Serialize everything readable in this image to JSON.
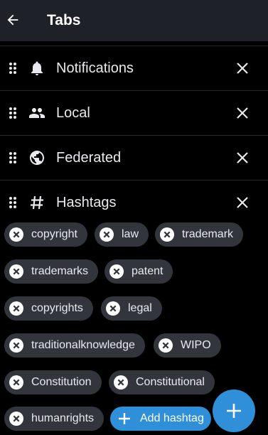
{
  "appbar": {
    "title": "Tabs"
  },
  "tabs": [
    {
      "label": "Notifications",
      "icon": "bell-icon"
    },
    {
      "label": "Local",
      "icon": "people-icon"
    },
    {
      "label": "Federated",
      "icon": "globe-icon"
    },
    {
      "label": "Hashtags",
      "icon": "hash-icon"
    }
  ],
  "hashtags": [
    "copyright",
    "law",
    "trademark",
    "trademarks",
    "patent",
    "copyrights",
    "legal",
    "traditionalknowledge",
    "WIPO",
    "Constitution",
    "Constitutional",
    "humanrights"
  ],
  "add_hashtag_label": "Add hashtag",
  "colors": {
    "accent": "#2f8fd8",
    "chip": "#32363c",
    "appbar": "#1e2228"
  }
}
